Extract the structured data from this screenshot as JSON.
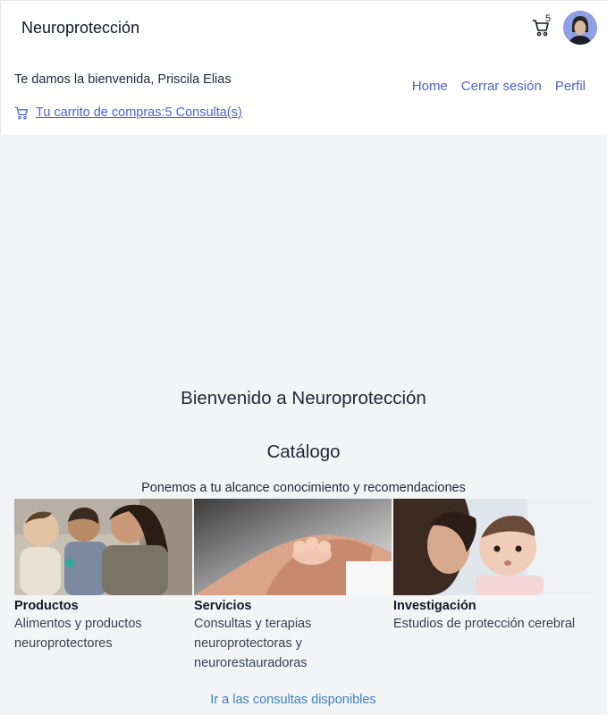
{
  "header": {
    "brand": "Neuroprotección",
    "cart_count": "5",
    "welcome": "Te damos la bienvenida, Priscila Elias",
    "cart_link": "Tu carrito de compras:5 Consulta(s)",
    "nav": [
      "Home",
      "Cerrar sesión",
      "Perfil"
    ]
  },
  "main": {
    "title": "Bienvenido a Neuroprotección",
    "catalog_title": "Catálogo",
    "tagline": "Ponemos a tu alcance conocimiento y recomendaciones",
    "cards": [
      {
        "title": "Productos",
        "desc_lines": [
          "Alimentos y productos",
          "neuroprotectores"
        ]
      },
      {
        "title": "Servicios",
        "desc_lines": [
          "Consultas y terapias",
          "neuroprotectoras y",
          "neurorestauradoras"
        ]
      },
      {
        "title": "Investigación",
        "desc_lines": [
          "Estudios de protección cerebral"
        ]
      }
    ],
    "cta": "Ir a las consultas disponibles"
  },
  "colors": {
    "link": "#4f5fd6",
    "cta": "#3b82c4",
    "background": "#f3f4f6",
    "avatar_bg": "#8ea0e6"
  },
  "icons": [
    "cart-icon",
    "avatar"
  ]
}
